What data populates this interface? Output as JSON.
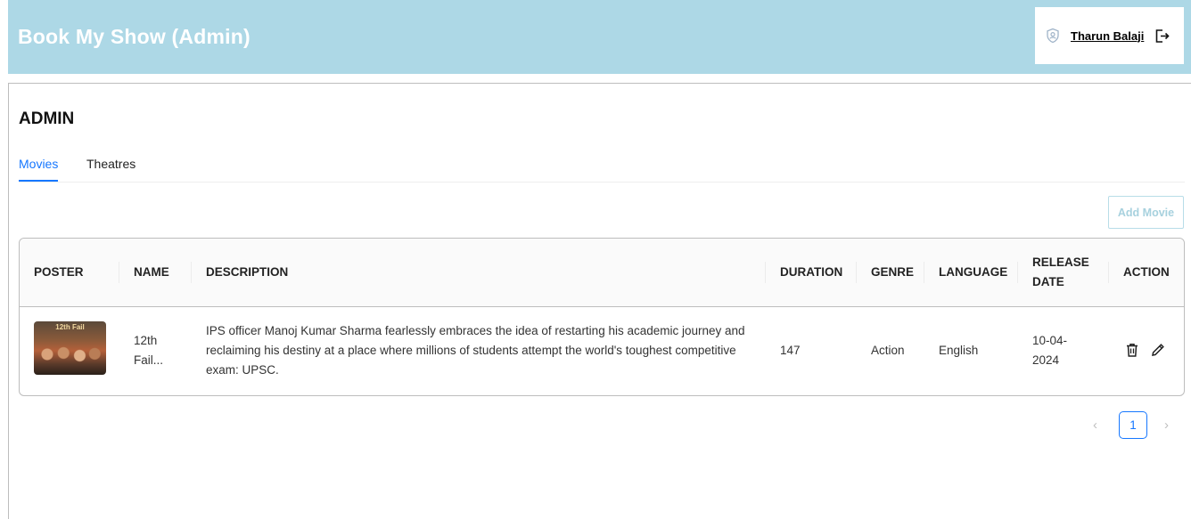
{
  "header": {
    "title": "Book My Show (Admin)",
    "user_name": "Tharun Balaji",
    "user_icon": "shield-user-icon",
    "logout_icon": "logout-icon"
  },
  "page": {
    "title": "ADMIN",
    "tabs": [
      {
        "label": "Movies",
        "active": true
      },
      {
        "label": "Theatres",
        "active": false
      }
    ],
    "add_button": "Add Movie"
  },
  "table": {
    "columns": [
      "POSTER",
      "NAME",
      "DESCRIPTION",
      "DURATION",
      "GENRE",
      "LANGUAGE",
      "RELEASE DATE",
      "ACTION"
    ],
    "rows": [
      {
        "poster_text": "12th Fail",
        "name": "12th Fail...",
        "description": "IPS officer Manoj Kumar Sharma fearlessly embraces the idea of restarting his academic journey and reclaiming his destiny at a place where millions of students attempt the world's toughest competitive exam: UPSC.",
        "duration": "147",
        "genre": "Action",
        "language": "English",
        "release_date": "10-04-2024",
        "actions": [
          "delete-icon",
          "edit-icon"
        ]
      }
    ]
  },
  "pagination": {
    "prev": "‹",
    "current_page": "1",
    "next": "›"
  },
  "colors": {
    "header_bg": "#add8e6",
    "accent": "#1677ff"
  }
}
